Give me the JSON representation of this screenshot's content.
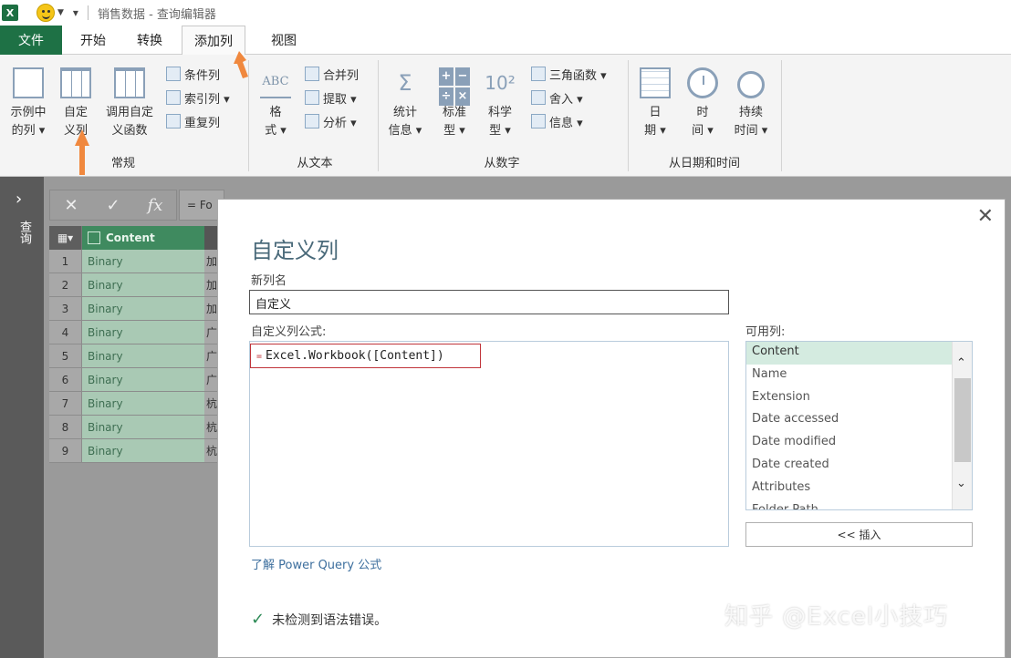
{
  "title_bar": {
    "app_icon_text": "X",
    "title": "销售数据 - 查询编辑器"
  },
  "tabs": [
    {
      "label": "文件"
    },
    {
      "label": "开始"
    },
    {
      "label": "转换"
    },
    {
      "label": "添加列"
    },
    {
      "label": "视图"
    }
  ],
  "ribbon": {
    "general": {
      "example_col": {
        "line1": "示例中",
        "line2": "的列 ▾"
      },
      "custom_col": {
        "line1": "自定",
        "line2": "义列"
      },
      "invoke_func": {
        "line1": "调用自定",
        "line2": "义函数"
      },
      "conditional": "条件列",
      "index": "索引列 ▾",
      "duplicate": "重复列",
      "group_label": "常规"
    },
    "from_text": {
      "format": {
        "line1": "格",
        "line2": "式 ▾"
      },
      "merge": "合并列",
      "extract": "提取 ▾",
      "parse": "分析 ▾",
      "group_label": "从文本"
    },
    "from_number": {
      "stats": {
        "line1": "统计",
        "line2": "信息 ▾"
      },
      "standard": {
        "line1": "标准",
        "line2": "型 ▾"
      },
      "science": {
        "line1": "科学",
        "line2": "型 ▾"
      },
      "trig": "三角函数 ▾",
      "round": "舍入 ▾",
      "info": "信息 ▾",
      "group_label": "从数字"
    },
    "from_datetime": {
      "date": {
        "line1": "日",
        "line2": "期 ▾"
      },
      "time": {
        "line1": "时",
        "line2": "间 ▾"
      },
      "duration": {
        "line1": "持续",
        "line2": "时间 ▾"
      },
      "group_label": "从日期和时间"
    }
  },
  "left_nav": {
    "label": "查询"
  },
  "formula_bar": {
    "cancel": "✕",
    "confirm": "✓",
    "fx": "fx",
    "text": "= Fo"
  },
  "grid": {
    "col_header": "Content",
    "rows": [
      {
        "n": "1",
        "v": "Binary",
        "t": "加"
      },
      {
        "n": "2",
        "v": "Binary",
        "t": "加"
      },
      {
        "n": "3",
        "v": "Binary",
        "t": "加"
      },
      {
        "n": "4",
        "v": "Binary",
        "t": "广"
      },
      {
        "n": "5",
        "v": "Binary",
        "t": "广"
      },
      {
        "n": "6",
        "v": "Binary",
        "t": "广"
      },
      {
        "n": "7",
        "v": "Binary",
        "t": "杭"
      },
      {
        "n": "8",
        "v": "Binary",
        "t": "杭"
      },
      {
        "n": "9",
        "v": "Binary",
        "t": "杭"
      }
    ]
  },
  "dialog": {
    "title": "自定义列",
    "new_col_label": "新列名",
    "new_col_value": "自定义",
    "formula_label": "自定义列公式:",
    "formula_prefix": "=",
    "formula": "Excel.Workbook([Content])",
    "available_label": "可用列:",
    "available_cols": [
      "Content",
      "Name",
      "Extension",
      "Date accessed",
      "Date modified",
      "Date created",
      "Attributes",
      "Folder Path"
    ],
    "insert_btn": "<< 插入",
    "learn_link": "了解 Power Query 公式",
    "status": "未检测到语法错误。"
  },
  "watermark": "知乎 @Excel小技巧",
  "colors": {
    "excel_green": "#1e7145",
    "highlight_red": "#c0343a",
    "arrow_orange": "#f0883e"
  }
}
